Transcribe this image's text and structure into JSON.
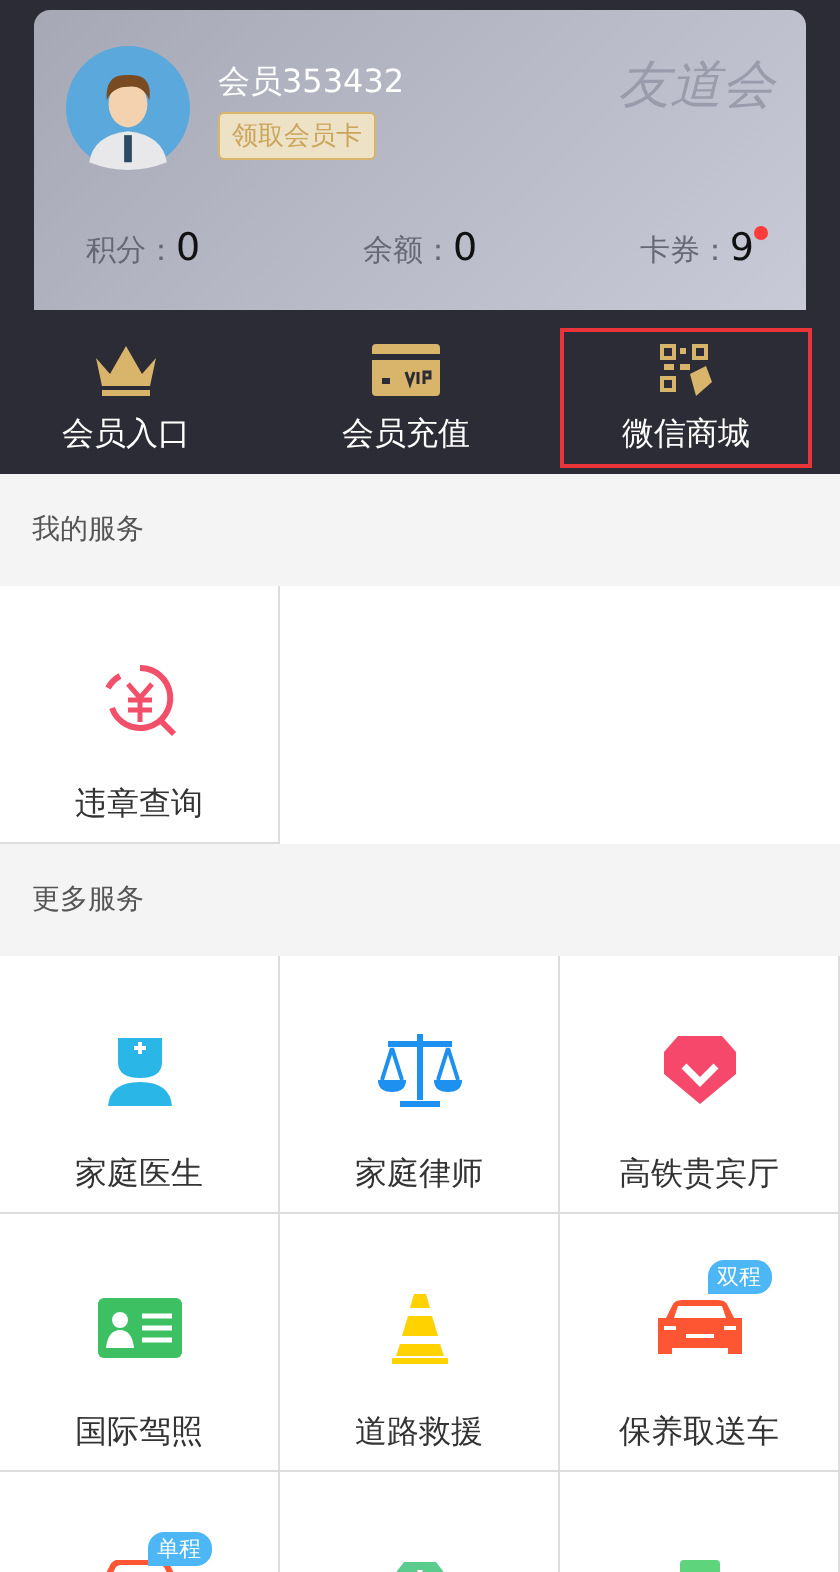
{
  "member": {
    "name": "会员353432",
    "card_button": "领取会员卡",
    "logo": "友道会",
    "stats": [
      {
        "label": "积分：",
        "value": "0",
        "dot": false
      },
      {
        "label": "余额：",
        "value": "0",
        "dot": false
      },
      {
        "label": "卡券：",
        "value": "9",
        "dot": true
      }
    ]
  },
  "nav": [
    {
      "kind": "crown",
      "label": "会员入口",
      "selected": false
    },
    {
      "kind": "vip-card",
      "label": "会员充值",
      "selected": false
    },
    {
      "kind": "qr-tag",
      "label": "微信商城",
      "selected": true
    }
  ],
  "sections": [
    {
      "title": "我的服务",
      "items": [
        {
          "kind": "violation",
          "label": "违章查询"
        }
      ]
    },
    {
      "title": "更多服务",
      "items": [
        {
          "kind": "doctor",
          "label": "家庭医生"
        },
        {
          "kind": "scale",
          "label": "家庭律师"
        },
        {
          "kind": "diamond",
          "label": "高铁贵宾厅"
        },
        {
          "kind": "license",
          "label": "国际驾照"
        },
        {
          "kind": "cone",
          "label": "道路救援"
        },
        {
          "kind": "car",
          "label": "保养取送车",
          "badge": "双程"
        },
        {
          "kind": "car-outline",
          "badge": "单程"
        },
        {
          "kind": "green-diamond"
        },
        {
          "kind": "green-box"
        }
      ]
    }
  ]
}
